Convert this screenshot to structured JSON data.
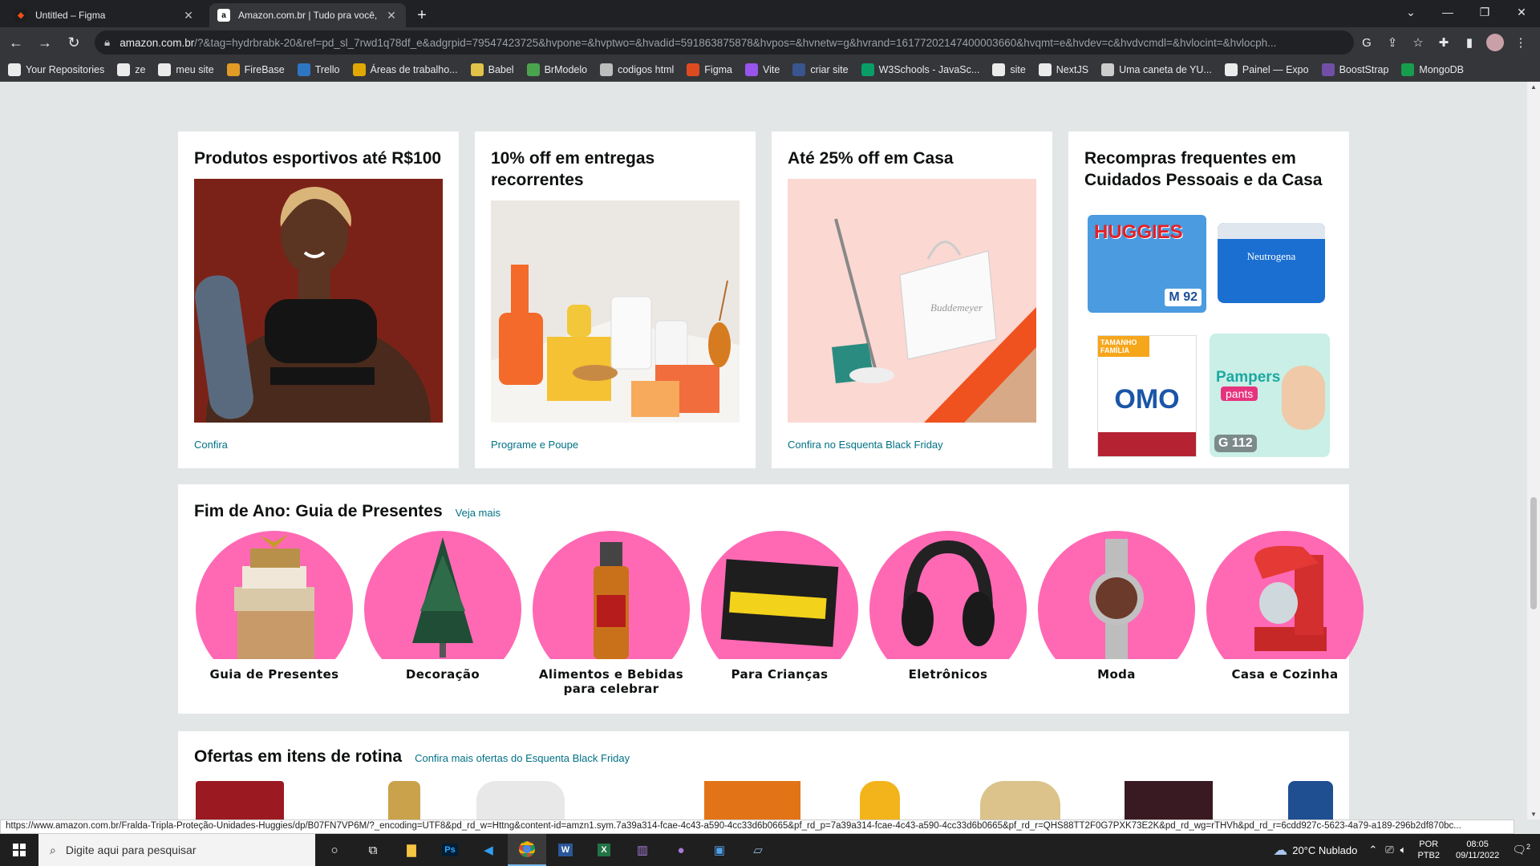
{
  "browser": {
    "tabs": [
      {
        "title": "Untitled – Figma",
        "active": false
      },
      {
        "title": "Amazon.com.br | Tudo pra você,",
        "active": true
      }
    ],
    "url_host": "amazon.com.br",
    "url_rest": "/?&tag=hydrbrabk-20&ref=pd_sl_7rwd1q78df_e&adgrpid=79547423725&hvpone=&hvptwo=&hvadid=591863875878&hvpos=&hvnetw=g&hvrand=16177202147400003660&hvqmt=e&hvdev=c&hvdvcmdl=&hvlocint=&hvlocph...",
    "bookmarks": [
      "Your Repositories",
      "ze",
      "meu site",
      "FireBase",
      "Trello",
      "Áreas de trabalho...",
      "Babel",
      "BrModelo",
      "codigos html",
      "Figma",
      "Vite",
      "criar site",
      "W3Schools - JavaSc...",
      "site",
      "NextJS",
      "Uma caneta de YU...",
      "Painel — Expo",
      "BoostStrap",
      "MongoDB"
    ]
  },
  "cards": [
    {
      "title": "Produtos esportivos até R$100",
      "link": "Confira"
    },
    {
      "title": "10% off em entregas recorrentes",
      "link": "Programe e Poupe"
    },
    {
      "title": "Até 25% off em Casa",
      "link": "Confira no Esquenta Black Friday"
    },
    {
      "title": "Recompras frequentes em Cuidados Pessoais e da Casa",
      "link": ""
    }
  ],
  "product_labels": {
    "huggies": "HUGGIES",
    "huggies_size": "M 92",
    "neutrogena": "Neutrogena",
    "omo": "OMO",
    "omo_tag": "TAMANHO FAMÍLIA",
    "pampers": "Pampers",
    "pampers_sub": "pants",
    "pampers_size": "G 112",
    "buddemeyer": "Buddemeyer"
  },
  "gift_guide": {
    "title": "Fim de Ano: Guia de Presentes",
    "link": "Veja mais",
    "items": [
      "Guia de Presentes",
      "Decoração",
      "Alimentos e Bebidas para celebrar",
      "Para Crianças",
      "Eletrônicos",
      "Moda",
      "Casa e Cozinha"
    ]
  },
  "routine": {
    "title": "Ofertas em itens de rotina",
    "link": "Confira mais ofertas do Esquenta Black Friday"
  },
  "status_url": "https://www.amazon.com.br/Fralda-Tripla-Proteção-Unidades-Huggies/dp/B07FN7VP6M/?_encoding=UTF8&pd_rd_w=Httng&content-id=amzn1.sym.7a39a314-fcae-4c43-a590-4cc33d6b0665&pf_rd_p=7a39a314-fcae-4c43-a590-4cc33d6b0665&pf_rd_r=QHS88TT2F0G7PXK73E2K&pd_rd_wg=rTHVh&pd_rd_r=6cdd927c-5623-4a79-a189-296b2df870bc...",
  "taskbar": {
    "search_placeholder": "Digite aqui para pesquisar",
    "weather": "20°C  Nublado",
    "lang1": "POR",
    "lang2": "PTB2",
    "time": "08:05",
    "date": "09/11/2022",
    "notif_count": "2"
  },
  "colors": {
    "link": "#007185",
    "pink": "#ff69b4",
    "tab_bg": "#202124"
  }
}
